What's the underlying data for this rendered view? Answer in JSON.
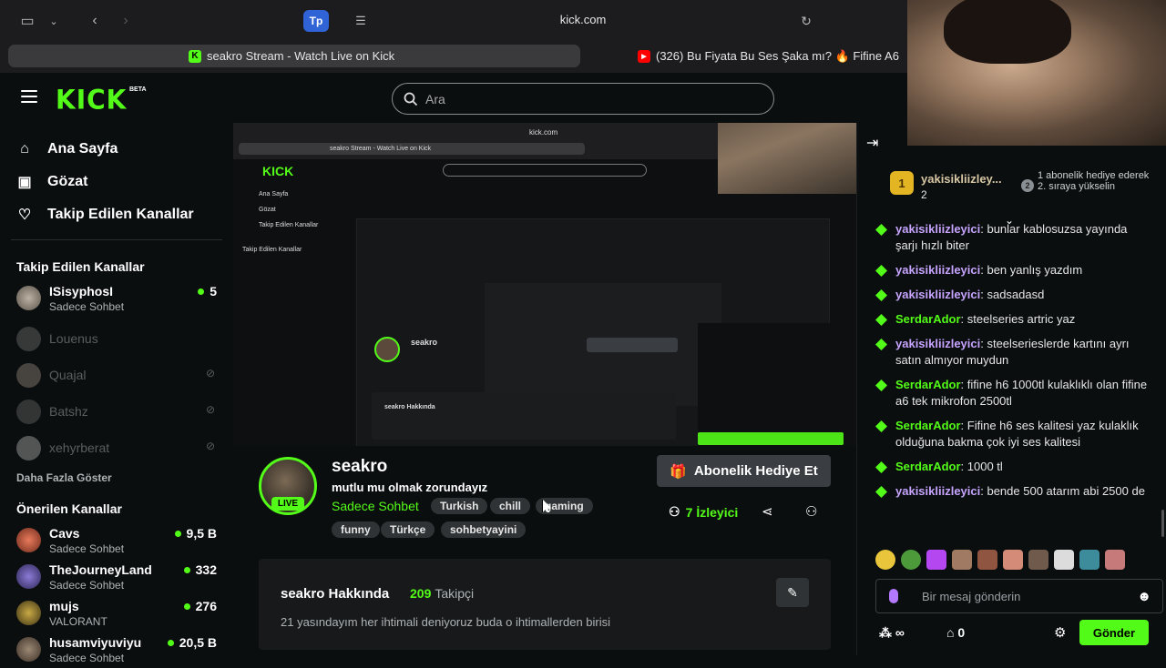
{
  "browser": {
    "url": "kick.com",
    "tp_label": "Tp",
    "tabs": [
      {
        "title": "seakro Stream - Watch Live on Kick",
        "favicon": "K",
        "active": true
      },
      {
        "title": "(326) Bu Fiyata Bu Ses Şaka mı? 🔥 Fifine A6",
        "favicon": "▶",
        "active": false
      }
    ]
  },
  "header": {
    "logo": "KICK",
    "logo_beta": "BETA",
    "search_placeholder": "Ara"
  },
  "sidebar": {
    "nav": [
      {
        "label": "Ana Sayfa",
        "icon": "home-icon"
      },
      {
        "label": "Gözat",
        "icon": "browse-icon"
      },
      {
        "label": "Takip Edilen Kanallar",
        "icon": "heart-icon"
      }
    ],
    "followed_title": "Takip Edilen Kanallar",
    "followed": [
      {
        "name": "ISisyphosI",
        "category": "Sadece Sohbet",
        "viewers": "5",
        "online": true
      },
      {
        "name": "Louenus",
        "online": false
      },
      {
        "name": "Quajal",
        "online": false
      },
      {
        "name": "Batshz",
        "online": false
      },
      {
        "name": "xehyrberat",
        "online": false
      }
    ],
    "show_more": "Daha Fazla Göster",
    "recommended_title": "Önerilen Kanallar",
    "recommended": [
      {
        "name": "Cavs",
        "category": "Sadece Sohbet",
        "viewers": "9,5 B"
      },
      {
        "name": "TheJourneyLand",
        "category": "Sadece Sohbet",
        "viewers": "332"
      },
      {
        "name": "mujs",
        "category": "VALORANT",
        "viewers": "276"
      },
      {
        "name": "husamviyuviyu",
        "category": "Sadece Sohbet",
        "viewers": "20,5 B"
      }
    ]
  },
  "stream": {
    "streamer": "seakro",
    "title": "mutlu mu olmak zorundayız",
    "category": "Sadece Sohbet",
    "live_label": "LIVE",
    "tags": [
      "Turkish",
      "chill",
      "gaming",
      "funny",
      "Türkçe",
      "sohbetyayini"
    ],
    "gift_button": "Abonelik Hediye Et",
    "viewers": "7",
    "viewers_label": "İzleyici",
    "about_title": "seakro Hakkında",
    "followers": "209",
    "followers_label": "Takipçi",
    "description": "21 yasındayım her ihtimali deniyoruz buda o ihtimallerden birisi"
  },
  "chat": {
    "pinned": {
      "rank": "1",
      "name": "yakisikliizley...",
      "count": "2",
      "rank2": "2",
      "text": "1 abonelik hediye ederek 2. sıraya yükselin"
    },
    "messages": [
      {
        "user": "yakisikliizleyici",
        "color": "purple",
        "text": "bunlar kablosuzsa yayında şarjı hızlı biter"
      },
      {
        "user": "yakisikliizleyici",
        "color": "purple",
        "text": "ben yanlış yazdım"
      },
      {
        "user": "yakisikliizleyici",
        "color": "purple",
        "text": "sadsadasd"
      },
      {
        "user": "SerdarAdor",
        "color": "green",
        "text": "steelseries artric yaz"
      },
      {
        "user": "yakisikliizleyici",
        "color": "purple",
        "text": "steelserieslerde kartını ayrı satın almıyor muydun"
      },
      {
        "user": "SerdarAdor",
        "color": "green",
        "text": "fifine h6 1000tl kulaklıklı olan fifine a6 tek mikrofon 2500tl"
      },
      {
        "user": "SerdarAdor",
        "color": "green",
        "text": "Fifine h6 ses kalitesi yaz kulaklık olduğuna bakma çok iyi ses kalitesi"
      },
      {
        "user": "SerdarAdor",
        "color": "green",
        "text": "1000 tl"
      },
      {
        "user": "yakisikliizleyici",
        "color": "purple",
        "text": "bende 500 atarım abi 2500 de"
      }
    ],
    "input_placeholder": "Bir mesaj gönderin",
    "points": "∞",
    "coins": "0",
    "send_label": "Gönder"
  },
  "video_overlay": {
    "inner_url": "kick.com",
    "inner_tab": "seakro Stream - Watch Live on Kick",
    "inner_tab2": "(326) Bu Fiyata Bu Ses Şaka mı? 🔥 Fifine A6"
  }
}
